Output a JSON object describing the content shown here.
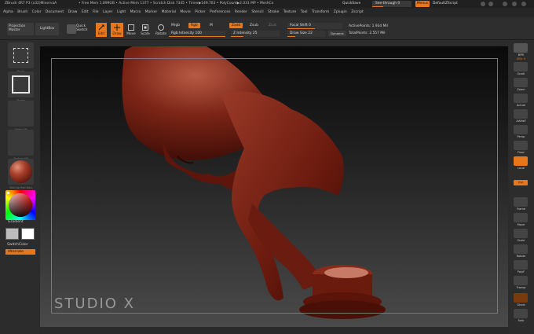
{
  "titlebar": {
    "title": "ZBrush 4R7 P3 (x32)MinervaA",
    "stats": "• Free Mem 1.899GB • Active Mem 1377 • Scratch Disk 7345 • Timer▶149.703 • PolyCount▶2.031 MP • MeshCo",
    "quicksave": "QuickSave",
    "seethrough": "See-through  0",
    "menus": "Menus",
    "script": "DefaultZScript"
  },
  "menubar": {
    "items": [
      "Alpha",
      "Brush",
      "Color",
      "Document",
      "Draw",
      "Edit",
      "File",
      "Layer",
      "Light",
      "Macro",
      "Marker",
      "Material",
      "Movie",
      "Picker",
      "Preferences",
      "Render",
      "Stencil",
      "Stroke",
      "Texture",
      "Tool",
      "Transform",
      "Zplugin",
      "Zscript"
    ]
  },
  "toolbar": {
    "projection_master": "Projection Master",
    "lightbox": "LightBox",
    "quick_sketch": "Quick Sketch",
    "edit": "Edit",
    "draw": "Draw",
    "move": "Move",
    "scale": "Scale",
    "rotate": "Rotate",
    "mrgb": "Mrgb",
    "rgb": "Rgb",
    "m": "M",
    "rgb_intensity": "Rgb Intensity 100",
    "zadd": "Zadd",
    "zsub": "Zsub",
    "zcut": "Zcut",
    "z_intensity": "Z Intensity 25",
    "focal_shift": "Focal Shift 0",
    "draw_size": "Draw Size 22",
    "dynamic": "Dynamic",
    "active_points": "ActivePoints: 1.934 Mil",
    "total_points": "TotalPoints: 2.557 Mil"
  },
  "lefttray": {
    "labels": [
      "Brush",
      "Stroke",
      "Alpha Off",
      "Texture Off",
      "MatCap Red Wax"
    ],
    "gradient": "Gradient",
    "switchcolor": "SwitchColor",
    "alternate": "Alternate"
  },
  "righttray": {
    "labels": [
      "BPR",
      "SPix 3",
      "Scroll",
      "Zoom",
      "Actual",
      "AAHalf",
      "Persp",
      "Floor",
      "Local",
      "Xyz",
      "Frame",
      "Move",
      "Scale",
      "Rotate",
      "PolyF",
      "Transp",
      "Ghost",
      "Solo"
    ]
  },
  "viewport": {
    "watermark": "STUDIO X"
  },
  "colors": {
    "accent": "#e8761a",
    "wax": "#7a1d12"
  }
}
